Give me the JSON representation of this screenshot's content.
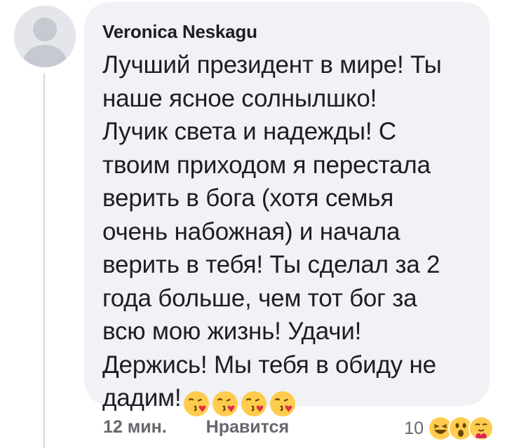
{
  "comment": {
    "author": "Veronica Neskagu",
    "lines": [
      "Лучший президент в мире! Ты",
      "наше ясное солнылшко!",
      "Лучик света и надежды! С",
      "твоим приходом я перестала",
      "верить в бога (хотя семья",
      "очень набожная) и начала",
      "верить в тебя! Ты сделал за 2",
      "года больше, чем тот бог за",
      "всю мою жизнь! Удачи!",
      "Держись! Мы тебя в обиду не",
      "дадим!"
    ],
    "trailing_emojis": [
      "kissing-heart-emoji",
      "kissing-heart-emoji",
      "kissing-heart-emoji",
      "kissing-heart-emoji"
    ]
  },
  "footer": {
    "timestamp": "12 мин.",
    "like_label": "Нравится",
    "reaction_count": "10",
    "reaction_icons": [
      "haha-icon",
      "wow-icon",
      "care-icon"
    ]
  },
  "colors": {
    "bubble": "#f0f2f5",
    "text": "#1c1e21",
    "secondary_text": "#65676b",
    "emoji_yellow": "#ffcc4d"
  }
}
